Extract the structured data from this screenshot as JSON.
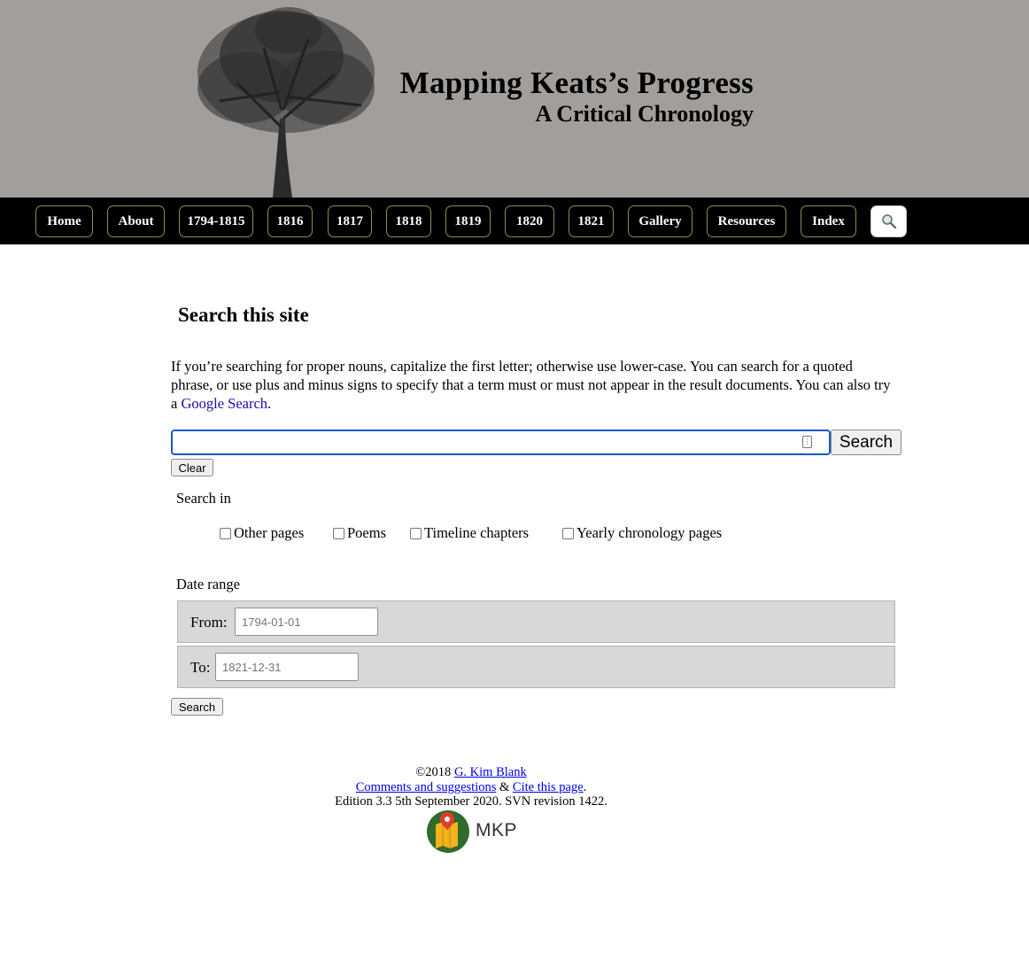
{
  "banner": {
    "title": "Mapping Keats’s Progress",
    "subtitle": "A Critical Chronology",
    "background": "#a29e9b"
  },
  "nav": {
    "items": [
      {
        "label": "Home"
      },
      {
        "label": "About"
      },
      {
        "label": "1794-1815"
      },
      {
        "label": "1816"
      },
      {
        "label": "1817"
      },
      {
        "label": "1818"
      },
      {
        "label": "1819"
      },
      {
        "label": "1820"
      },
      {
        "label": "1821"
      },
      {
        "label": "Gallery"
      },
      {
        "label": "Resources"
      },
      {
        "label": "Index"
      }
    ],
    "search_icon": "magnifier-icon"
  },
  "main": {
    "title": "Search this site",
    "intro_text": "If you’re searching for proper nouns, capitalize the first letter; otherwise use lower-case. You can search for a quoted phrase, or use plus and minus signs to specify that a term must or must not appear in the result documents. You can also try a ",
    "intro_link": "Google Search",
    "intro_end": ".",
    "search_value": "",
    "search_button": "Search",
    "clear_button": "Clear",
    "search_in_label": "Search in",
    "checkboxes": [
      {
        "label": "Other pages",
        "checked": false
      },
      {
        "label": "Poems",
        "checked": false
      },
      {
        "label": "Timeline chapters",
        "checked": false
      },
      {
        "label": "Yearly chronology pages",
        "checked": false
      }
    ],
    "date_range_label": "Date range",
    "from_label": "From:",
    "from_placeholder": "1794-01-01",
    "to_label": "To:",
    "to_placeholder": "1821-12-31",
    "submit_button": "Search"
  },
  "footer": {
    "copyright": "©2018 ",
    "author_link": "G. Kim Blank",
    "comments_link": "Comments and suggestions",
    "amp": " & ",
    "cite_link": "Cite this page",
    "cite_end": ".",
    "edition": "Edition 3.3 5th September 2020. SVN revision 1422.",
    "logo_text": "MKP"
  }
}
